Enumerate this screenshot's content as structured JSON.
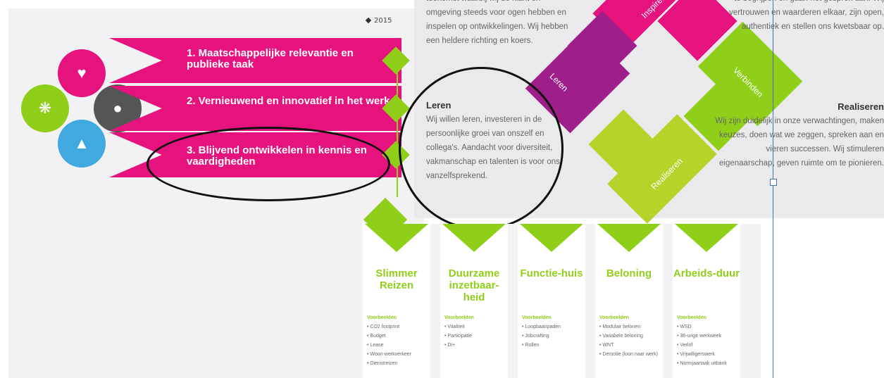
{
  "year_label": "2015",
  "banners": [
    {
      "text": "1. Maatschappelijke relevantie en publieke taak"
    },
    {
      "text": "2. Vernieuwend en innovatief in het werk"
    },
    {
      "text": "3. Blijvend ontwikkelen in kennis en vaardigheden"
    }
  ],
  "right": {
    "t1": "toekomst waarbij wij de klant en omgeving steeds voor ogen hebben en inspelen op ontwikkelingen. Wij hebben een heldere richting en koers.",
    "leren_title": "Leren",
    "leren_body": "Wij willen leren, investeren in de persoonlijke groei van onszelf en collega's. Aandacht voor diversiteit, vakmanschap en talenten is voor ons vanzelfsprekend.",
    "t3": "te begrijpen en gaan het gesprek aan. Wij vertrouwen en waarderen elkaar, zijn open, authentiek en stellen ons kwetsbaar op.",
    "realiseren_title": "Realiseren",
    "realiseren_body": "Wij zijn duidelijk in onze verwachtingen, maken keuzes, doen wat we zeggen, spreken aan en vieren successen. Wij stimuleren eigenaarschap, geven ruimte om te pionieren.",
    "shape_labels": {
      "inspireren": "Inspireren",
      "leren": "Leren",
      "verbinden": "Verbinden",
      "realiseren": "Realiseren"
    }
  },
  "cards": [
    {
      "title": "Slimmer Reizen",
      "sub": "Voorbeelden",
      "items": [
        "CO2 footprint",
        "Budget",
        "Lease",
        "Woon-werkverkeer",
        "Dienstreizen"
      ]
    },
    {
      "title": "Duurzame inzetbaar-heid",
      "sub": "Voorbeelden",
      "items": [
        "Vitaliteit",
        "Participatie",
        "DI+"
      ]
    },
    {
      "title": "Functie-huis",
      "sub": "Voorbeelden",
      "items": [
        "Loopbaanpaden",
        "Jobcrafting",
        "Rollen"
      ]
    },
    {
      "title": "Beloning",
      "sub": "Voorbeelden",
      "items": [
        "Modulair belonen",
        "Variabele beloning",
        "WNT",
        "Demotie (loon naar werk)"
      ]
    },
    {
      "title": "Arbeids-duur",
      "sub": "Voorbeelden",
      "items": [
        "WSD",
        "36-urige werkweek",
        "Verlof",
        "Vrijwilligerswerk",
        "Normjaartaak uitbank"
      ]
    }
  ]
}
